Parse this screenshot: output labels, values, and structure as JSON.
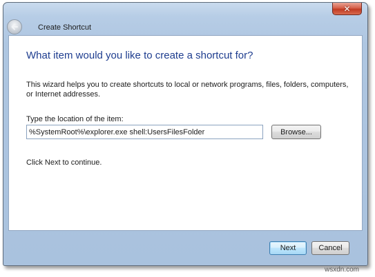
{
  "window": {
    "title": "Create Shortcut",
    "close_symbol": "✕"
  },
  "icons": {
    "back": "back-arrow-icon",
    "close": "close-icon"
  },
  "colors": {
    "heading": "#1e3d8f",
    "close_button": "#c13b23",
    "glass_frame": "#b7cde6"
  },
  "wizard": {
    "heading": "What item would you like to create a shortcut for?",
    "description": "This wizard helps you to create shortcuts to local or network programs, files, folders, computers, or Internet addresses.",
    "location_label": "Type the location of the item:",
    "location_value": "%SystemRoot%\\explorer.exe shell:UsersFilesFolder",
    "browse_label": "Browse...",
    "continue_text": "Click Next to continue."
  },
  "footer": {
    "next_label": "Next",
    "cancel_label": "Cancel"
  },
  "watermark": "wsxdn.com"
}
